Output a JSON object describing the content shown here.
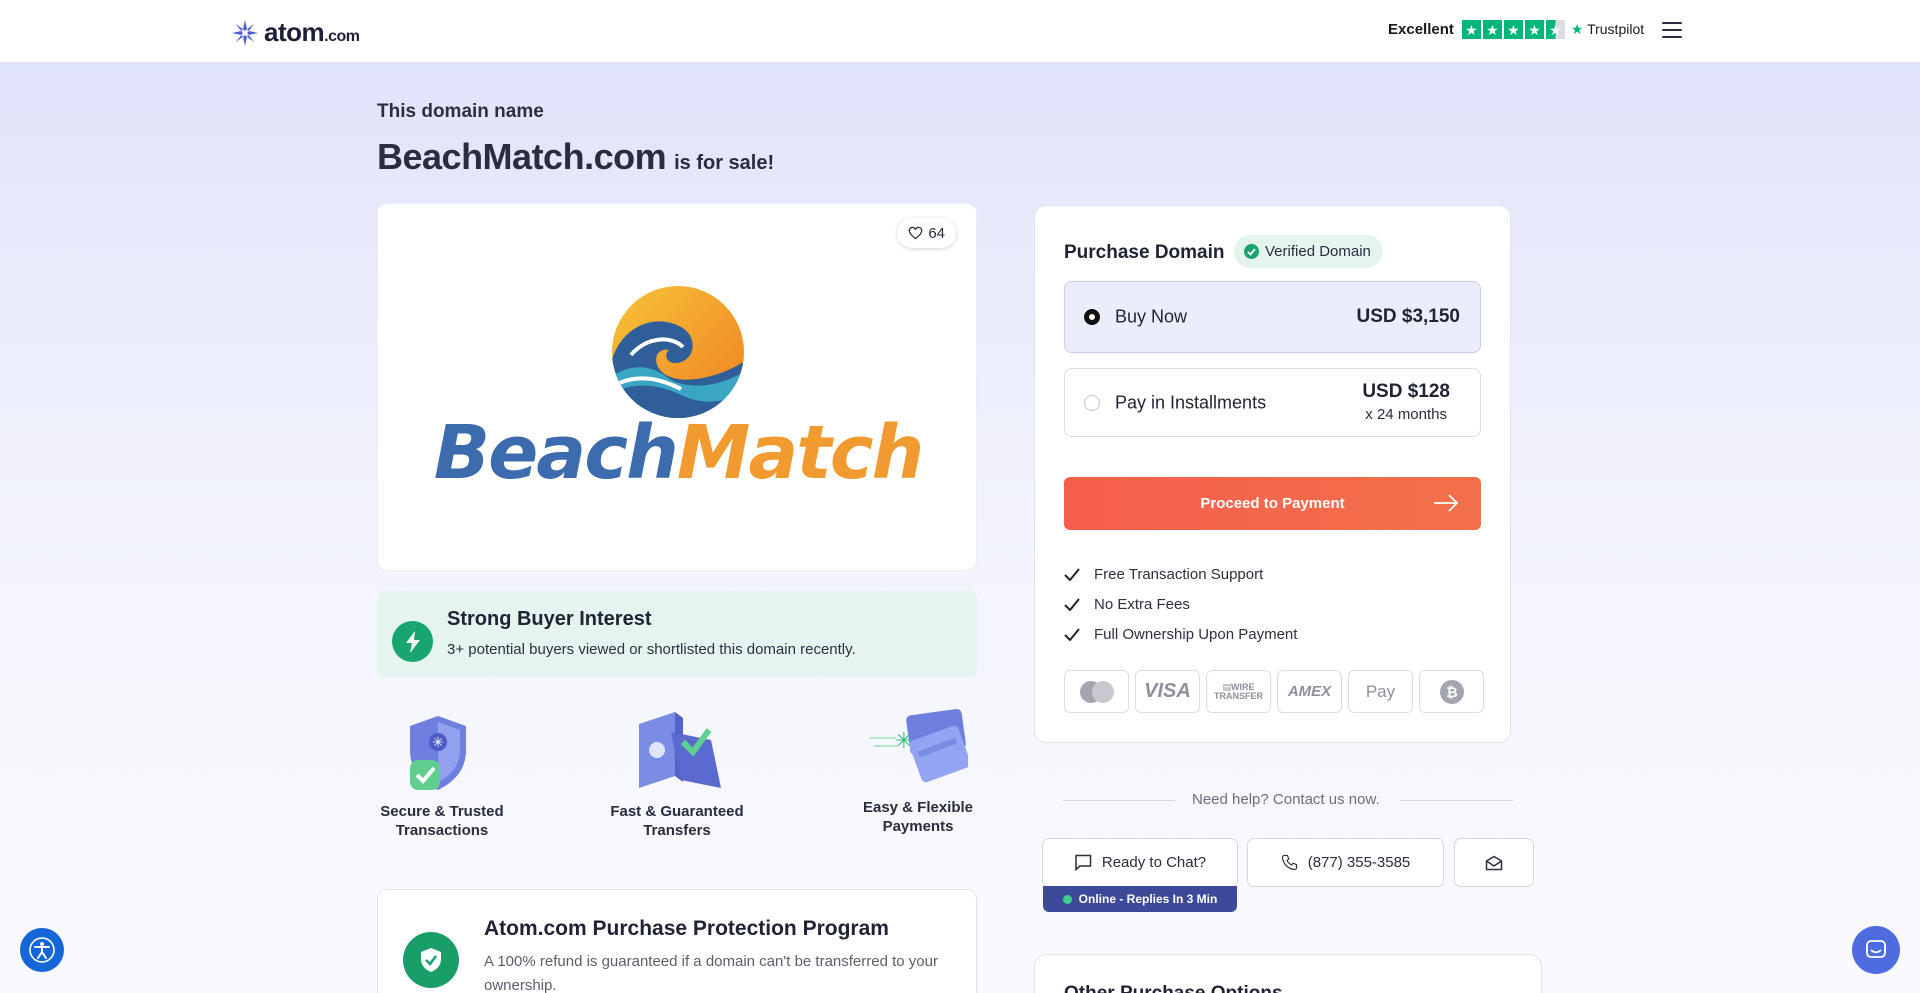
{
  "header": {
    "logo_text": "atom",
    "logo_tld": ".com",
    "trustpilot_rating": "Excellent",
    "trustpilot_stars": 4.5,
    "trustpilot_name": "Trustpilot"
  },
  "hero": {
    "kicker": "This domain name",
    "domain": "BeachMatch.com",
    "suffix": "is for sale!"
  },
  "logo_card": {
    "likes": "64",
    "brand_part1": "Beach",
    "brand_part2": "Match"
  },
  "interest": {
    "title": "Strong Buyer Interest",
    "text": "3+ potential buyers viewed or shortlisted this domain recently."
  },
  "features": [
    {
      "line1": "Secure & Trusted",
      "line2": "Transactions",
      "icon": "shield-check-icon"
    },
    {
      "line1": "Fast & Guaranteed",
      "line2": "Transfers",
      "icon": "transfer-icon"
    },
    {
      "line1": "Easy & Flexible",
      "line2": "Payments",
      "icon": "cards-icon"
    }
  ],
  "protection": {
    "title": "Atom.com Purchase Protection Program",
    "text": "A 100% refund is guaranteed if a domain can't be transferred to your ownership."
  },
  "purchase": {
    "title": "Purchase Domain",
    "verified": "Verified Domain",
    "options": [
      {
        "label": "Buy Now",
        "price": "USD $3,150",
        "selected": true
      },
      {
        "label": "Pay in Installments",
        "price": "USD $128",
        "sub": "x 24 months",
        "selected": false
      }
    ],
    "cta": "Proceed to Payment",
    "checks": [
      "Free Transaction Support",
      "No Extra Fees",
      "Full Ownership Upon Payment"
    ],
    "payment_methods": [
      "mastercard",
      "VISA",
      "WIRE TRANSFER",
      "AMEX",
      "Pay",
      "bitcoin"
    ]
  },
  "help": {
    "text": "Need help? Contact us now.",
    "chat": "Ready to Chat?",
    "online": "Online - Replies In 3 Min",
    "phone": "(877) 355-3585"
  },
  "other": {
    "title": "Other Purchase Options"
  },
  "colors": {
    "cta": "#f55f4d",
    "green": "#18a56f",
    "brand_blue": "#3c6cae",
    "brand_orange": "#f19a2f"
  }
}
